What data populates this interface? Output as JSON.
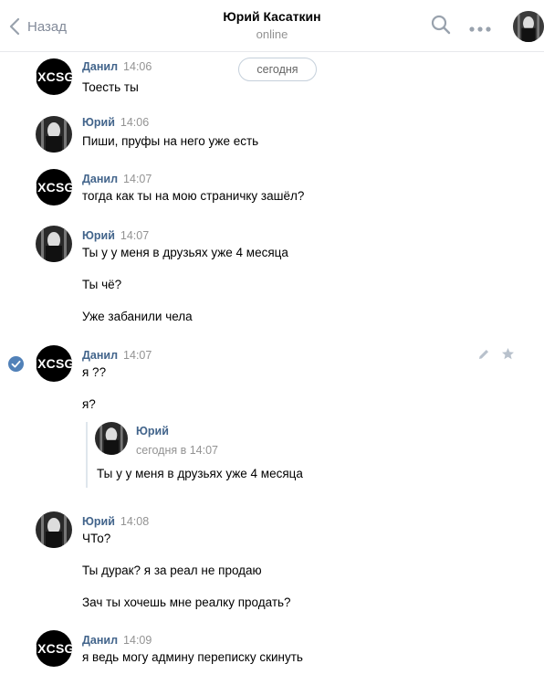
{
  "header": {
    "back_label": "Назад",
    "title": "Юрий Касаткин",
    "status": "online",
    "icons": [
      "chevron-left-icon",
      "search-icon",
      "more-icon",
      "avatar"
    ]
  },
  "date_divider": "сегодня",
  "avatar_text": "IXCSGO",
  "messages": [
    {
      "author": "Данил",
      "time": "14:06",
      "lines": [
        "Тоесть ты"
      ]
    },
    {
      "author": "Юрий",
      "time": "14:06",
      "lines": [
        "Пиши, пруфы на него уже есть"
      ]
    },
    {
      "author": "Данил",
      "time": "14:07",
      "lines": [
        "тогда как ты на мою страничку зашёл?"
      ]
    },
    {
      "author": "Юрий",
      "time": "14:07",
      "lines": [
        "Ты у у меня в друзьях уже 4 месяца",
        "Ты чё?",
        "Уже забанили чела"
      ]
    },
    {
      "author": "Данил",
      "time": "14:07",
      "selected": true,
      "lines": [
        "я ??",
        "я?"
      ],
      "quote": {
        "author": "Юрий",
        "date": "сегодня в 14:07",
        "text": "Ты у у меня в друзьях уже 4 месяца"
      }
    },
    {
      "author": "Юрий",
      "time": "14:08",
      "lines": [
        "ЧТо?",
        "Ты дурак? я за реал не продаю",
        "Зач ты хочешь мне реалку продать?"
      ]
    },
    {
      "author": "Данил",
      "time": "14:09",
      "lines": [
        "я ведь могу админу переписку скинуть"
      ]
    }
  ]
}
